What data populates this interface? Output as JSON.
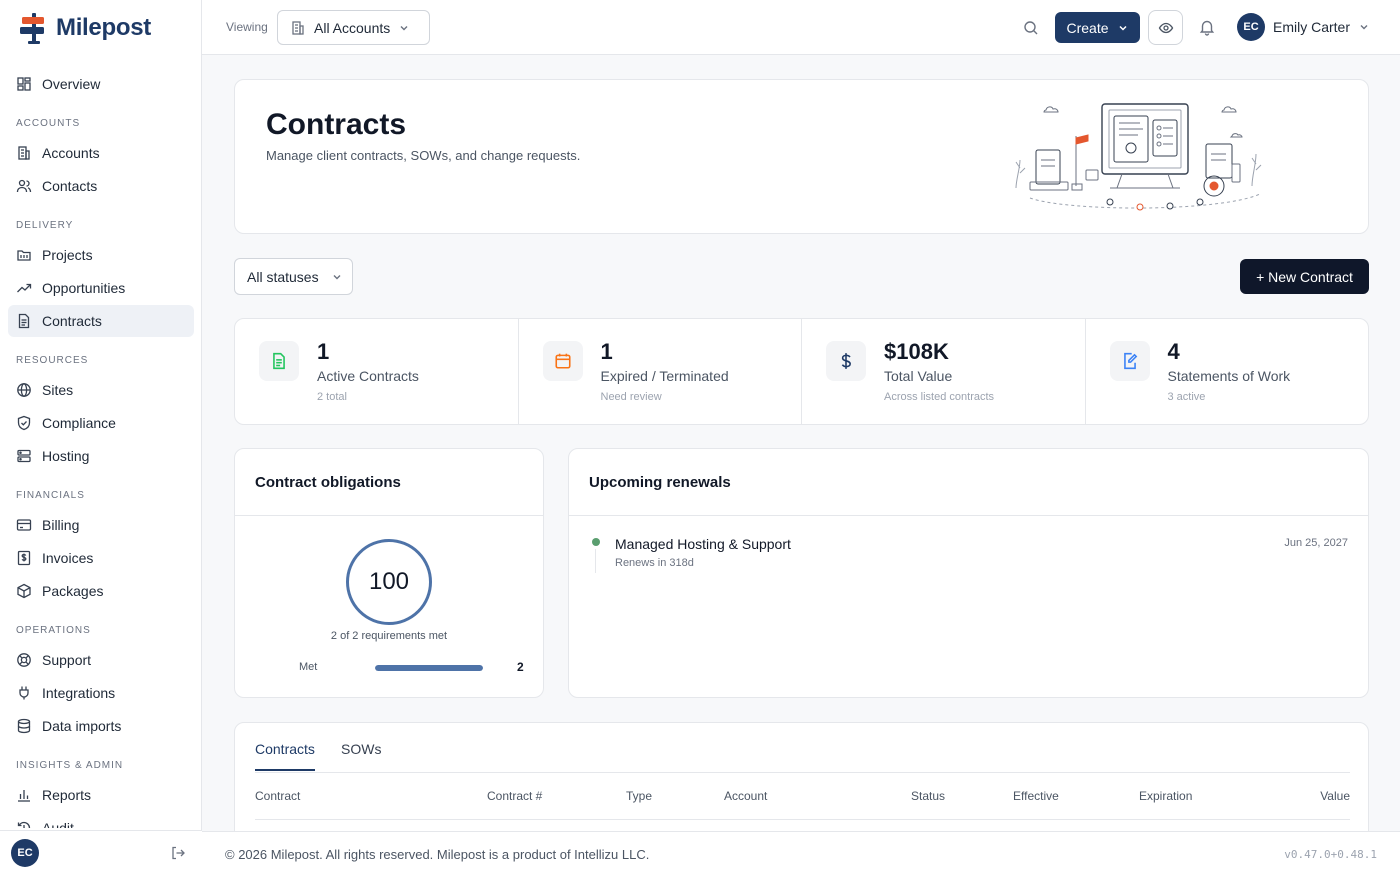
{
  "app": {
    "name": "Milepost"
  },
  "sidebar": {
    "items": [
      {
        "label": "Overview"
      },
      {
        "section": "ACCOUNTS"
      },
      {
        "label": "Accounts"
      },
      {
        "label": "Contacts"
      },
      {
        "section": "DELIVERY"
      },
      {
        "label": "Projects"
      },
      {
        "label": "Opportunities"
      },
      {
        "label": "Contracts",
        "active": true
      },
      {
        "section": "RESOURCES"
      },
      {
        "label": "Sites"
      },
      {
        "label": "Compliance"
      },
      {
        "label": "Hosting"
      },
      {
        "section": "FINANCIALS"
      },
      {
        "label": "Billing"
      },
      {
        "label": "Invoices"
      },
      {
        "label": "Packages"
      },
      {
        "section": "OPERATIONS"
      },
      {
        "label": "Support"
      },
      {
        "label": "Integrations"
      },
      {
        "label": "Data imports"
      },
      {
        "section": "INSIGHTS & ADMIN"
      },
      {
        "label": "Reports"
      },
      {
        "label": "Audit"
      }
    ],
    "user_initials": "EC"
  },
  "header": {
    "viewing_label": "Viewing",
    "account_select": "All Accounts",
    "create_label": "Create",
    "user_initials": "EC",
    "user_name": "Emily Carter"
  },
  "hero": {
    "title": "Contracts",
    "subtitle": "Manage client contracts, SOWs, and change requests."
  },
  "filters": {
    "status": "All statuses",
    "new_contract_label": "+ New Contract"
  },
  "stats": [
    {
      "value": "1",
      "label": "Active Contracts",
      "sub": "2 total"
    },
    {
      "value": "1",
      "label": "Expired / Terminated",
      "sub": "Need review"
    },
    {
      "value": "$108K",
      "label": "Total Value",
      "sub": "Across listed contracts"
    },
    {
      "value": "4",
      "label": "Statements of Work",
      "sub": "3 active"
    }
  ],
  "obligations": {
    "title": "Contract obligations",
    "score": "100",
    "caption": "2 of 2 requirements met",
    "met_label": "Met",
    "met_count": "2",
    "met_fraction": 1.0
  },
  "renewals": {
    "title": "Upcoming renewals",
    "items": [
      {
        "name": "Managed Hosting & Support",
        "sub": "Renews in 318d",
        "date": "Jun 25, 2027"
      }
    ]
  },
  "table": {
    "tabs": [
      "Contracts",
      "SOWs"
    ],
    "active_tab": 0,
    "columns": [
      "Contract",
      "Contract #",
      "Type",
      "Account",
      "Status",
      "Effective",
      "Expiration",
      "Value"
    ]
  },
  "footer": {
    "copyright": "© 2026 Milepost. All rights reserved. Milepost is a product of Intellizu LLC.",
    "version": "v0.47.0+0.48.1"
  },
  "colors": {
    "brand": "#1e3a66",
    "accent_orange": "#e4572e",
    "success": "#5a9e6f"
  }
}
